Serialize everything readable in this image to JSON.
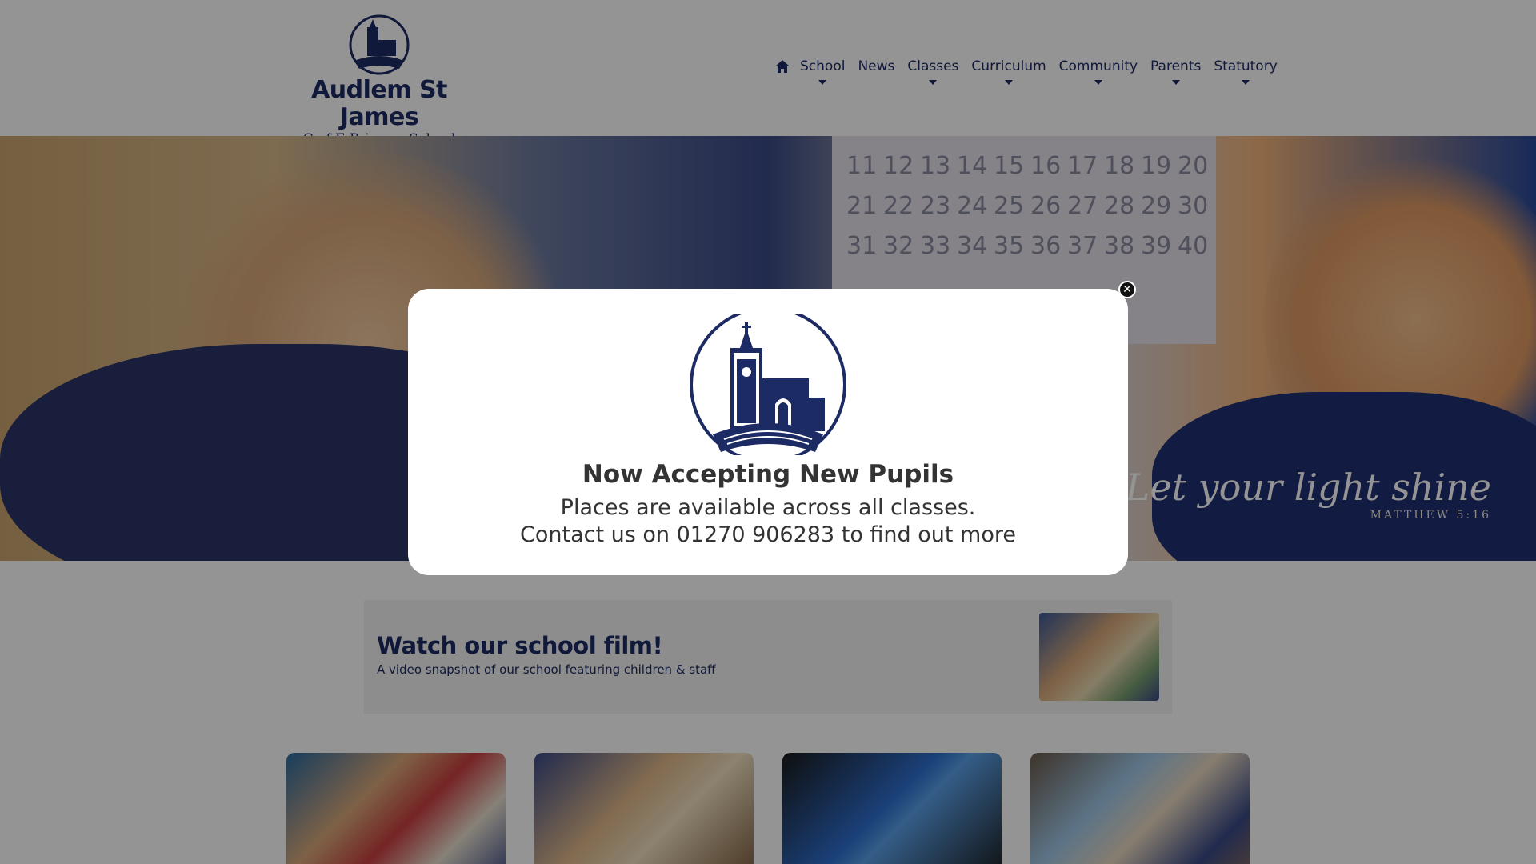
{
  "header": {
    "school_name": "Audlem St James",
    "school_subtitle": "C of E Primary School"
  },
  "nav": {
    "items": [
      {
        "label": "School",
        "has_dropdown": true
      },
      {
        "label": "News",
        "has_dropdown": false
      },
      {
        "label": "Classes",
        "has_dropdown": true
      },
      {
        "label": "Curriculum",
        "has_dropdown": true
      },
      {
        "label": "Community",
        "has_dropdown": true
      },
      {
        "label": "Parents",
        "has_dropdown": true
      },
      {
        "label": "Statutory",
        "has_dropdown": true
      }
    ]
  },
  "hero": {
    "quote": "Let your light shine",
    "reference": "MATTHEW 5:16",
    "number_chart": [
      "11",
      "12",
      "13",
      "14",
      "15",
      "16",
      "17",
      "18",
      "19",
      "20",
      "21",
      "22",
      "23",
      "24",
      "25",
      "26",
      "27",
      "28",
      "29",
      "30",
      "31",
      "32",
      "33",
      "34",
      "35",
      "36",
      "37",
      "38",
      "39",
      "40"
    ]
  },
  "film": {
    "title": "Watch our school film!",
    "subtitle": "A video snapshot of our school featuring children & staff"
  },
  "modal": {
    "title": "Now Accepting New Pupils",
    "line1": "Places are available across all classes.",
    "line2": "Contact us on 01270 906283 to find out more"
  },
  "colors": {
    "brand_navy": "#1c2b63",
    "overlay": "rgba(0,0,0,0.42)",
    "modal_bg": "#ffffff"
  },
  "icons": {
    "home": "home-icon",
    "close": "close-icon",
    "logo": "church-crest-icon"
  }
}
